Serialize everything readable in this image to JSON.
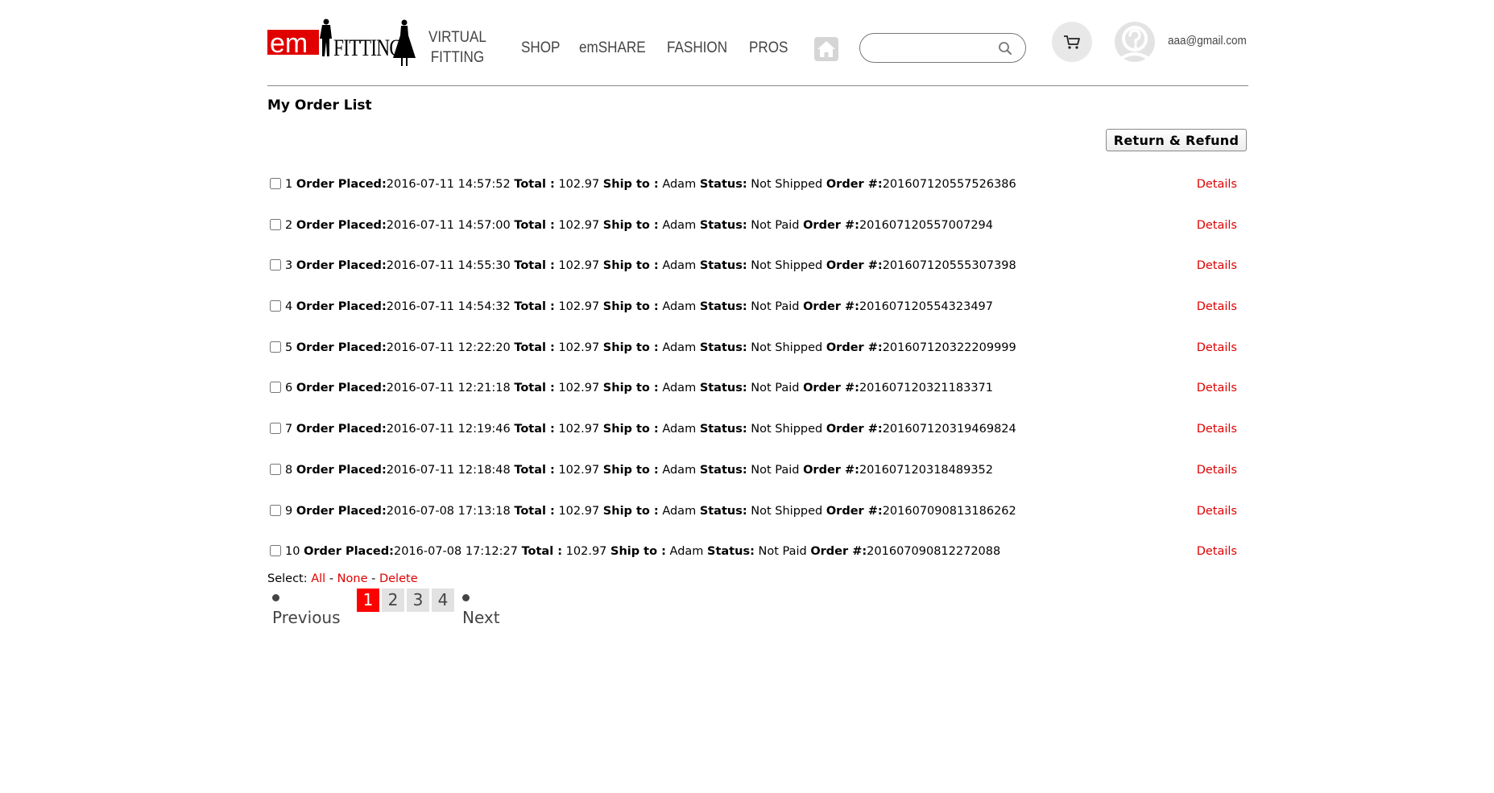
{
  "brand": {
    "logo_em": "em",
    "logo_fitting": "FITTING",
    "red": "#e00000"
  },
  "nav": {
    "items": [
      {
        "label": "VIRTUAL",
        "label2": "FITTING"
      },
      {
        "label": "SHOP"
      },
      {
        "label": "emSHARE"
      },
      {
        "label": "FASHION"
      },
      {
        "label": "PROS"
      }
    ]
  },
  "icons": {
    "home": "home-icon",
    "search": "search-icon",
    "cart": "cart-icon",
    "avatar": "avatar-icon"
  },
  "search": {
    "value": "",
    "placeholder": ""
  },
  "user": {
    "email": "aaa@gmail.com"
  },
  "page": {
    "title": "My Order List",
    "refund_button": "Return & Refund"
  },
  "labels": {
    "order_placed": "Order Placed",
    "total": "Total :",
    "ship_to": "Ship to :",
    "status": "Status:",
    "order_no": "Order #:",
    "details": "Details"
  },
  "orders": [
    {
      "n": "1",
      "placed": "2016-07-11 14:57:52",
      "total": "102.97",
      "ship_to": "Adam",
      "status": "Not Shipped",
      "order_no": "201607120557526386"
    },
    {
      "n": "2",
      "placed": "2016-07-11 14:57:00",
      "total": "102.97",
      "ship_to": "Adam",
      "status": "Not Paid",
      "order_no": "201607120557007294"
    },
    {
      "n": "3",
      "placed": "2016-07-11 14:55:30",
      "total": "102.97",
      "ship_to": "Adam",
      "status": "Not Shipped",
      "order_no": "201607120555307398"
    },
    {
      "n": "4",
      "placed": "2016-07-11 14:54:32",
      "total": "102.97",
      "ship_to": "Adam",
      "status": "Not Paid",
      "order_no": "201607120554323497"
    },
    {
      "n": "5",
      "placed": "2016-07-11 12:22:20",
      "total": "102.97",
      "ship_to": "Adam",
      "status": "Not Shipped",
      "order_no": "201607120322209999"
    },
    {
      "n": "6",
      "placed": "2016-07-11 12:21:18",
      "total": "102.97",
      "ship_to": "Adam",
      "status": "Not Paid",
      "order_no": "201607120321183371"
    },
    {
      "n": "7",
      "placed": "2016-07-11 12:19:46",
      "total": "102.97",
      "ship_to": "Adam",
      "status": "Not Shipped",
      "order_no": "201607120319469824"
    },
    {
      "n": "8",
      "placed": "2016-07-11 12:18:48",
      "total": "102.97",
      "ship_to": "Adam",
      "status": "Not Paid",
      "order_no": "201607120318489352"
    },
    {
      "n": "9",
      "placed": "2016-07-08 17:13:18",
      "total": "102.97",
      "ship_to": "Adam",
      "status": "Not Shipped",
      "order_no": "201607090813186262"
    },
    {
      "n": "10",
      "placed": "2016-07-08 17:12:27",
      "total": "102.97",
      "ship_to": "Adam",
      "status": "Not Paid",
      "order_no": "201607090812272088"
    }
  ],
  "select": {
    "label": "Select:",
    "all": "All",
    "none": "None",
    "delete": "Delete"
  },
  "pagination": {
    "previous": "Previous",
    "next": "Next",
    "pages": [
      "1",
      "2",
      "3",
      "4"
    ],
    "current": "1"
  }
}
